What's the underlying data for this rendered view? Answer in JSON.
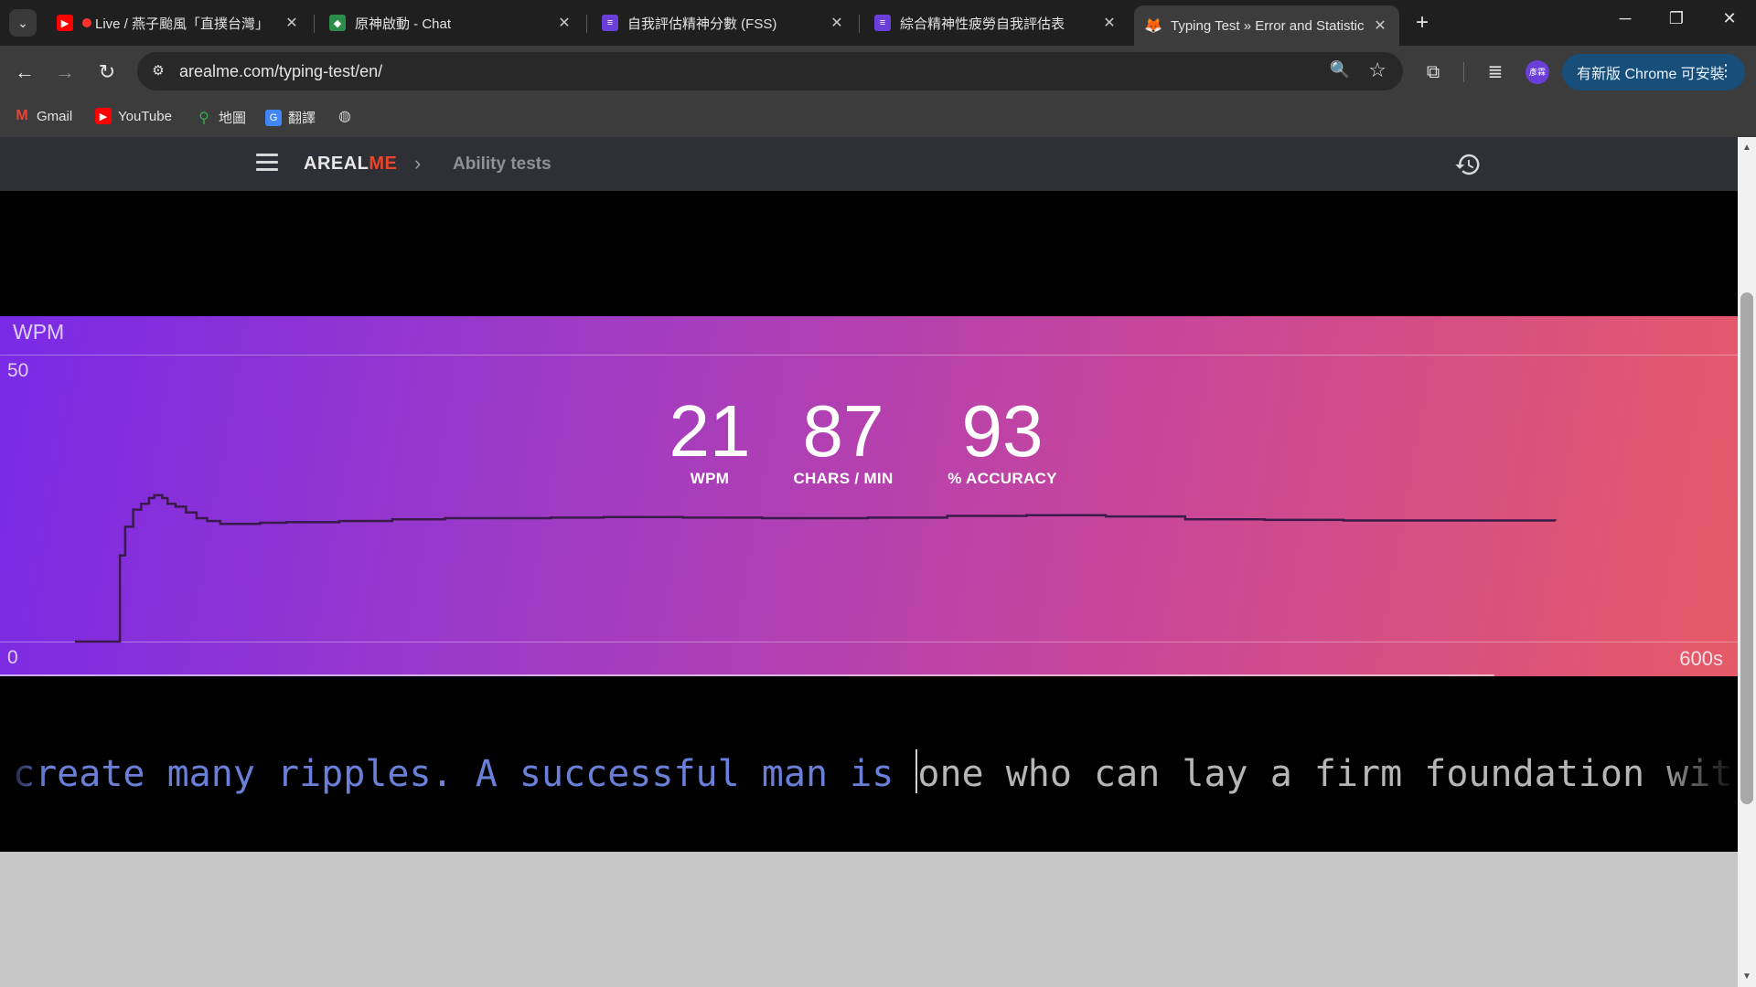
{
  "browser": {
    "tabs": [
      {
        "title": "Live / 燕子颱風「直撲台灣」",
        "favicon": "youtube-icon",
        "active": false
      },
      {
        "title": "原神啟動 - Chat",
        "favicon": "chat-icon",
        "active": false
      },
      {
        "title": "自我評估精神分數 (FSS)",
        "favicon": "forms-icon",
        "active": false
      },
      {
        "title": "綜合精神性疲勞自我評估表",
        "favicon": "forms-icon",
        "active": false
      },
      {
        "title": "Typing Test » Error and Statistics",
        "favicon": "fox-icon",
        "active": true
      }
    ],
    "url": "arealme.com/typing-test/en/",
    "update_button": "有新版 Chrome 可安裝",
    "profile_initial": "彥霖",
    "bookmarks": [
      {
        "label": "Gmail",
        "icon": "gmail-icon"
      },
      {
        "label": "YouTube",
        "icon": "youtube-icon"
      },
      {
        "label": "地圖",
        "icon": "maps-icon"
      },
      {
        "label": "翻譯",
        "icon": "translate-icon"
      },
      {
        "label": "",
        "icon": "globe-icon"
      }
    ]
  },
  "site": {
    "brand_left": "AREAL",
    "brand_right": "ME",
    "breadcrumb": "Ability tests"
  },
  "stats": {
    "wpm": {
      "value": "21",
      "label": "WPM"
    },
    "cpm": {
      "value": "87",
      "label": "CHARS / MIN"
    },
    "accuracy": {
      "value": "93",
      "label": "% ACCURACY"
    }
  },
  "chart_data": {
    "type": "line",
    "title": "WPM",
    "ylim": [
      0,
      50
    ],
    "xlim": [
      0,
      600
    ],
    "y_top_label": "50",
    "y_bottom_label": "0",
    "x_right_label": "600s",
    "progress_fraction": 0.86,
    "series": [
      {
        "x": [
          0,
          15,
          17,
          19,
          22,
          25,
          28,
          30,
          33,
          35,
          38,
          42,
          46,
          50,
          55,
          60,
          70,
          80,
          90,
          100,
          120,
          140,
          160,
          180,
          200,
          230,
          260,
          300,
          330,
          360,
          390,
          420,
          450,
          480,
          520,
          560
        ],
        "y": [
          0,
          0,
          15,
          20,
          23,
          24,
          25,
          25.5,
          25,
          24,
          23.5,
          22.5,
          21.5,
          21,
          20.5,
          20.5,
          20.7,
          20.8,
          20.8,
          21,
          21.3,
          21.5,
          21.5,
          21.6,
          21.7,
          21.6,
          21.5,
          21.6,
          21.9,
          22,
          21.8,
          21.3,
          21.2,
          21.1,
          21.1,
          21
        ]
      }
    ]
  },
  "typing": {
    "typed": "create many ripples. A successful man is ",
    "untyped": "one who can lay a firm foundation with the"
  }
}
